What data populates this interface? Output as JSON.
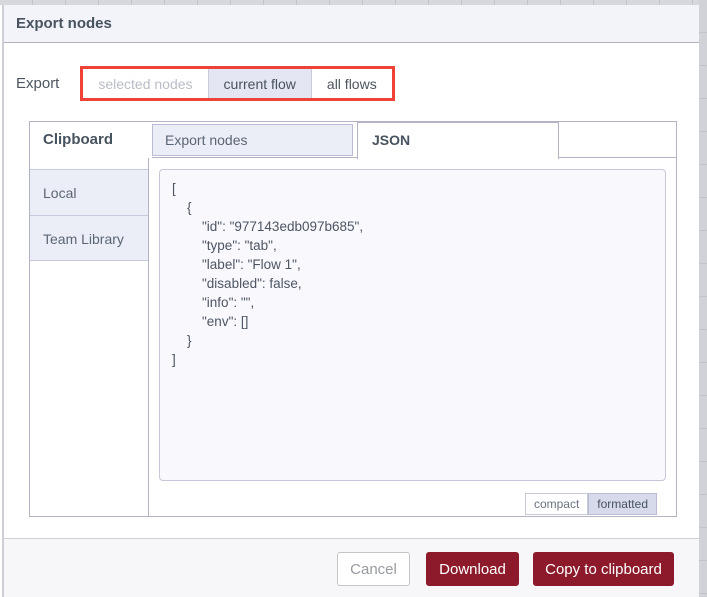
{
  "dialog": {
    "title": "Export nodes"
  },
  "export_row": {
    "label": "Export",
    "options": [
      {
        "label": "selected nodes",
        "state": "disabled"
      },
      {
        "label": "current flow",
        "state": "selected"
      },
      {
        "label": "all flows",
        "state": "normal"
      }
    ]
  },
  "panel": {
    "clipboard_label": "Clipboard",
    "tabs": [
      {
        "label": "Export nodes",
        "active": false
      },
      {
        "label": "JSON",
        "active": true
      }
    ],
    "sidebar": [
      {
        "label": "Local"
      },
      {
        "label": "Team Library"
      }
    ],
    "json_text": "[\n    {\n        \"id\": \"977143edb097b685\",\n        \"type\": \"tab\",\n        \"label\": \"Flow 1\",\n        \"disabled\": false,\n        \"info\": \"\",\n        \"env\": []\n    }\n]",
    "format_buttons": [
      {
        "label": "compact",
        "selected": false
      },
      {
        "label": "formatted",
        "selected": true
      }
    ]
  },
  "footer": {
    "cancel_label": "Cancel",
    "download_label": "Download",
    "copy_label": "Copy to clipboard"
  },
  "colors": {
    "primary_button": "#8c1a2b",
    "annotation_highlight": "#ee4237",
    "selected_fill": "#e4e6f3",
    "panel_fill": "#eceef7"
  }
}
